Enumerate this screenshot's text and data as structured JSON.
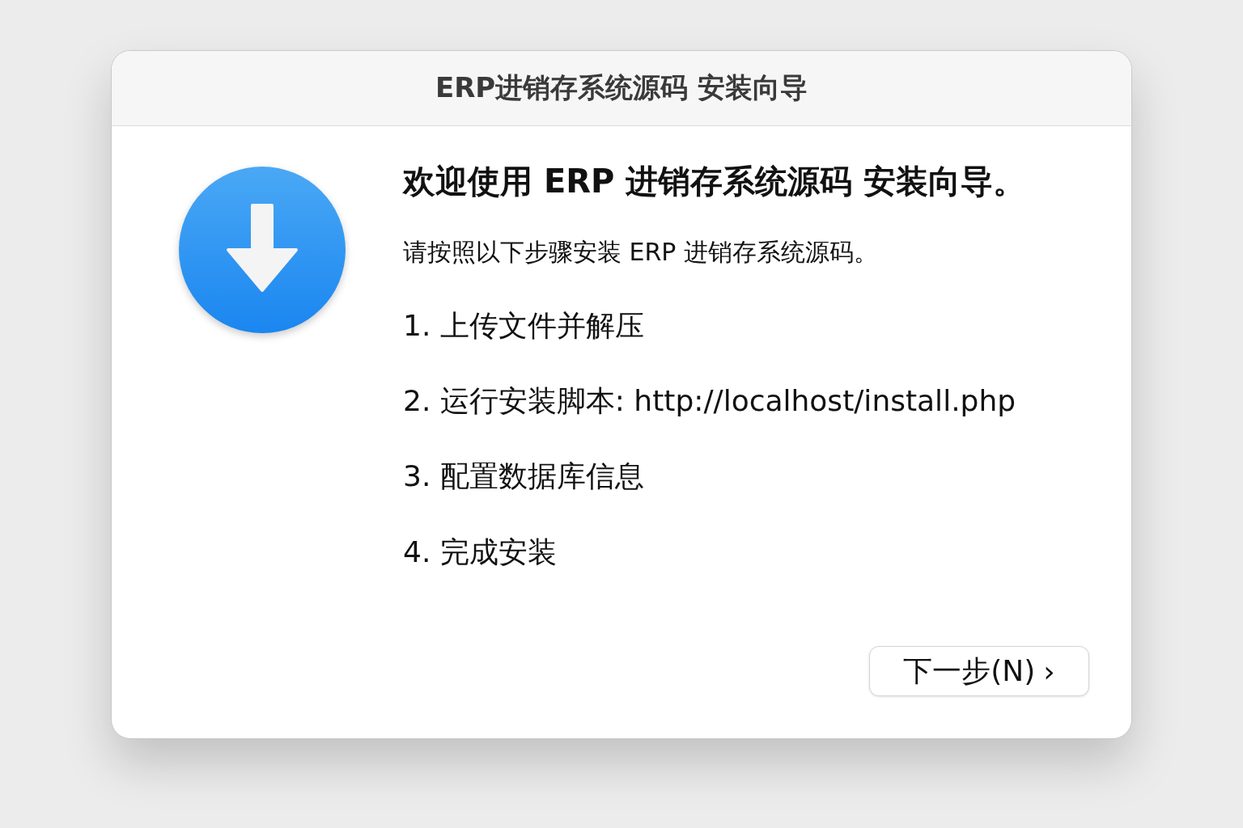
{
  "window": {
    "title": "ERP进销存系统源码 安装向导"
  },
  "heading": "欢迎使用 ERP 进销存系统源码 安装向导。",
  "intro": "请按照以下步骤安装 ERP 进销存系统源码。",
  "steps": [
    {
      "text": "1. 上传文件并解压"
    },
    {
      "text": "2. 运行安装脚本: http://localhost/install.php"
    },
    {
      "text": "3. 配置数据库信息"
    },
    {
      "text": "4. 完成安装"
    }
  ],
  "next_button": {
    "label": "下一步(N)",
    "chevron": "›"
  }
}
